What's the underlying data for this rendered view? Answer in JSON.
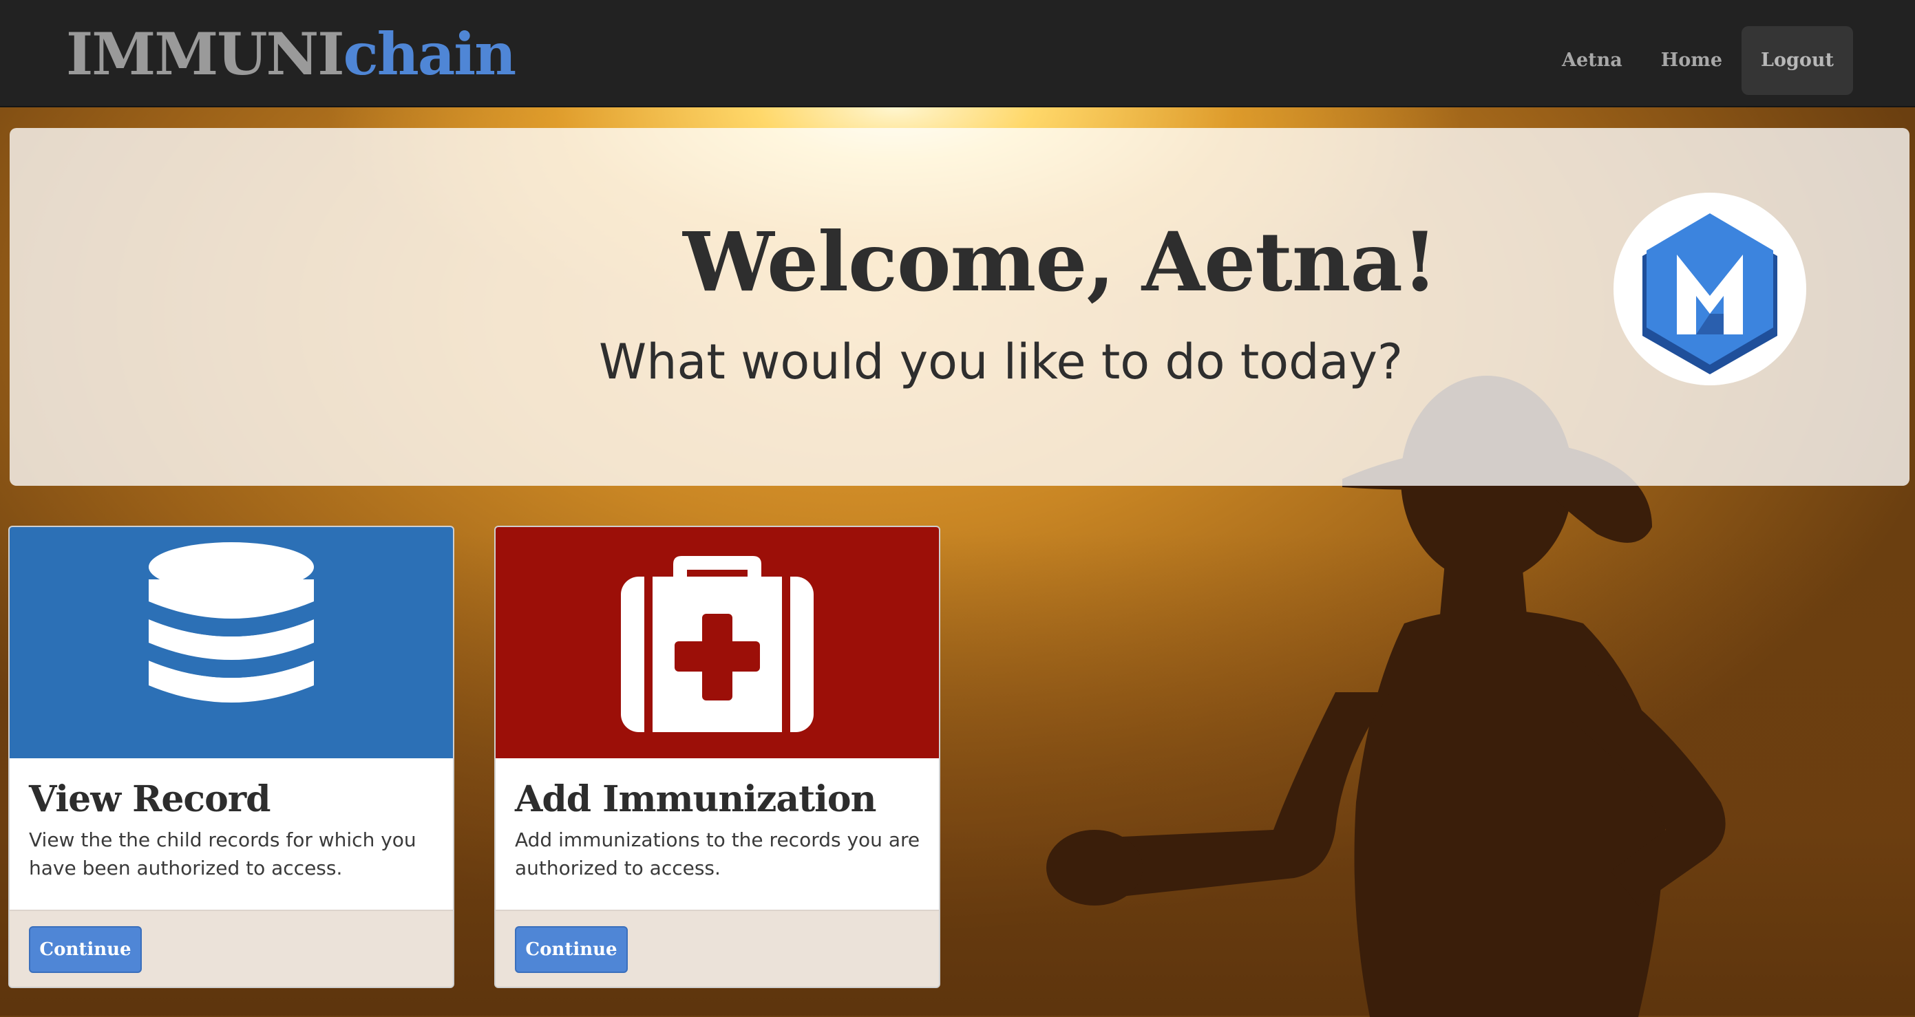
{
  "navbar": {
    "brand_part1": "IMMUNI",
    "brand_part2": "chain",
    "links": [
      {
        "label": "Aetna"
      },
      {
        "label": "Home"
      },
      {
        "label": "Logout"
      }
    ]
  },
  "welcome": {
    "title": "Welcome, Aetna!",
    "subtitle": "What would you like to do today?",
    "logo_icon": "hexagon-m-logo-icon"
  },
  "cards": [
    {
      "icon": "database-icon",
      "title": "View Record",
      "text": "View the the child records for which you have been authorized to access.",
      "button": "Continue",
      "color": "#2c70b6"
    },
    {
      "icon": "first-aid-kit-icon",
      "title": "Add Immunization",
      "text": "Add immunizations to the records you are authorized to access.",
      "button": "Continue",
      "color": "#9c0f08"
    }
  ],
  "colors": {
    "navbar_bg": "#222222",
    "brand_gray": "#9a9a9a",
    "brand_blue": "#4f86d6",
    "button_blue": "#4f86d6"
  }
}
